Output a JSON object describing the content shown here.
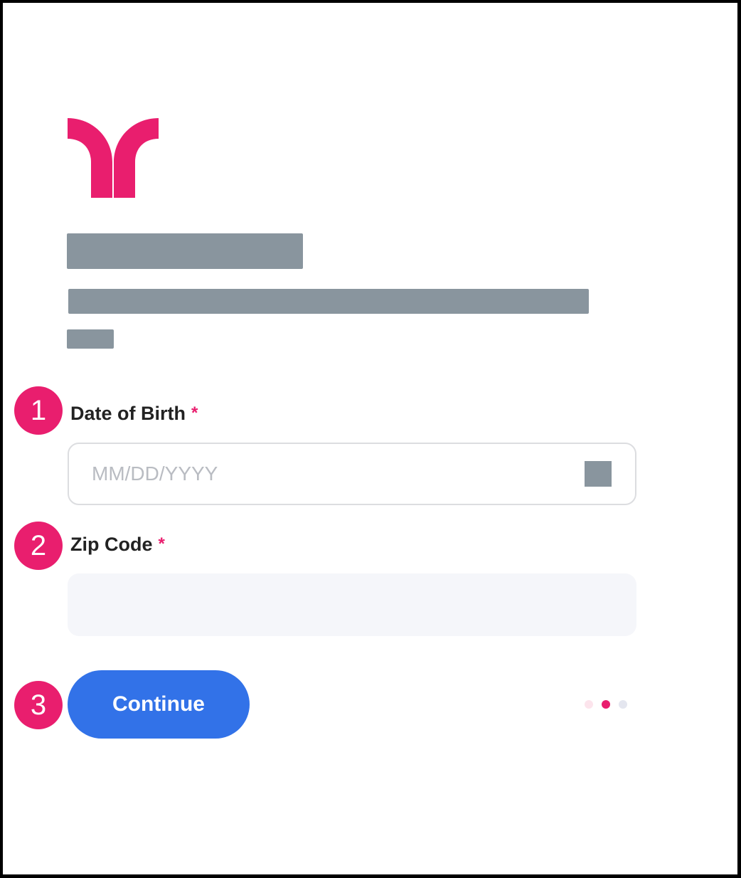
{
  "colors": {
    "brand": "#e91e6e",
    "button": "#3272e8",
    "redaction": "#89959e",
    "field_bg": "#f5f6fa",
    "dot_done": "#fce4ec",
    "dot_active": "#e91e6e",
    "dot_pending": "#e4e6ef"
  },
  "logo": {
    "icon": "brand-logo-icon"
  },
  "redactions": [
    "title",
    "description",
    "short-text"
  ],
  "form": {
    "dob": {
      "step": "1",
      "label": "Date of Birth",
      "required_mark": "*",
      "placeholder": "MM/DD/YYYY",
      "value": "",
      "icon": "calendar-icon"
    },
    "zip": {
      "step": "2",
      "label": "Zip Code",
      "required_mark": "*",
      "placeholder": "",
      "value": ""
    },
    "continue": {
      "step": "3",
      "label": "Continue"
    }
  },
  "progress": {
    "total": 3,
    "current": 2
  }
}
